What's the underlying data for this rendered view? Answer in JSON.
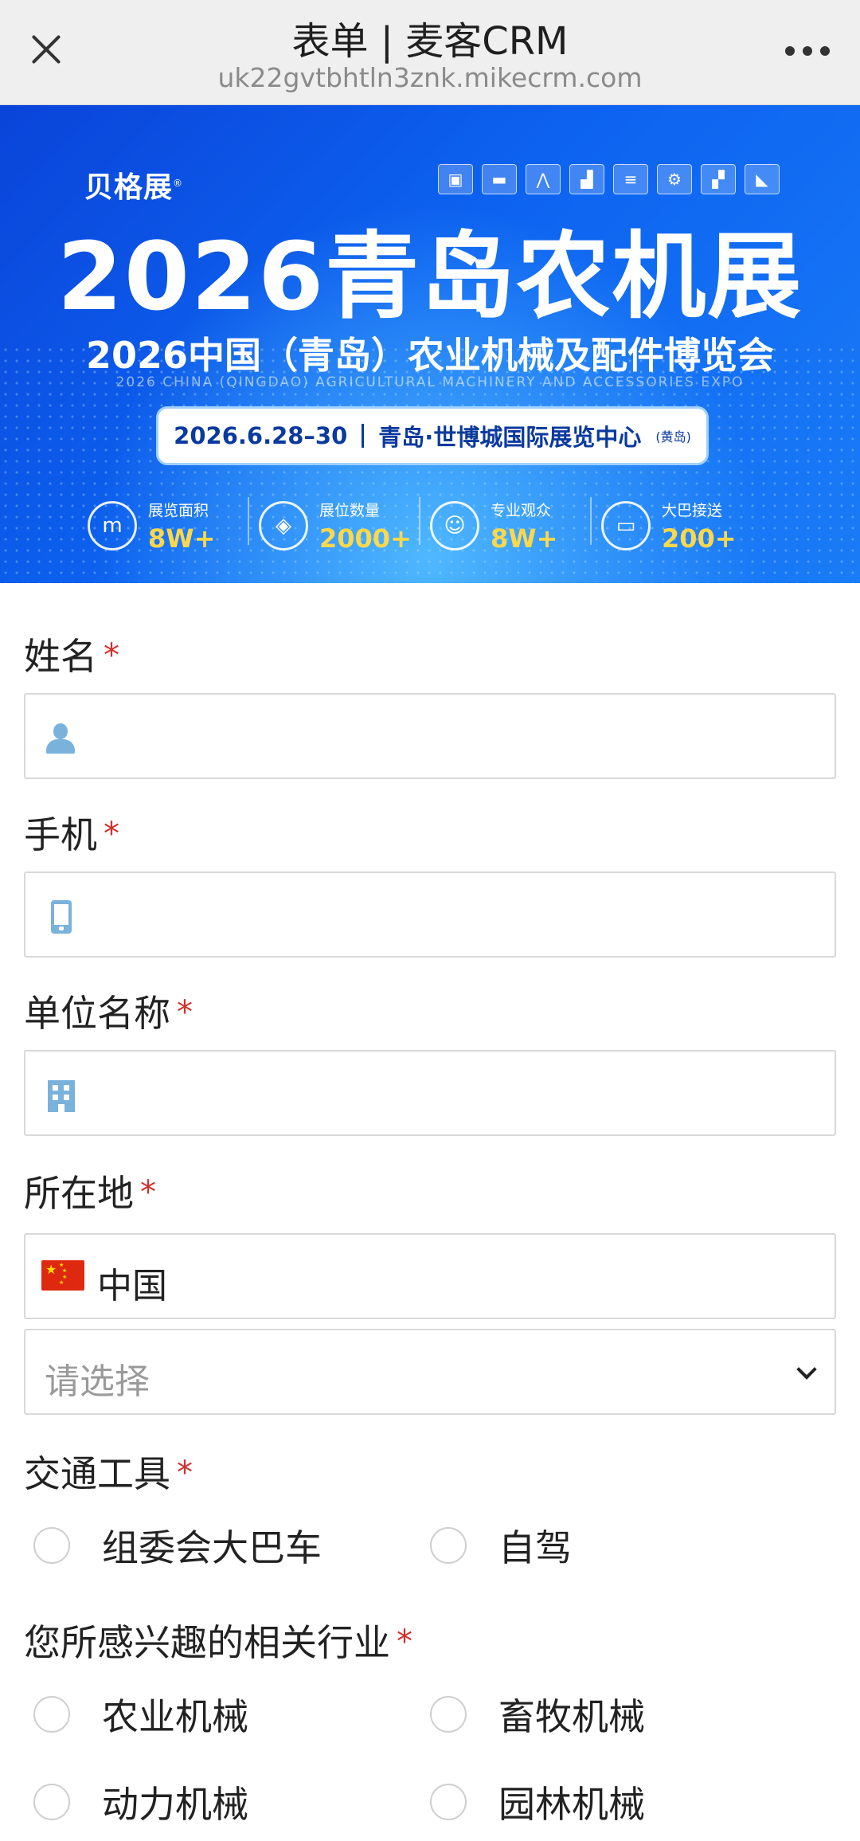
{
  "window": {
    "title": "表单 | 麦客CRM",
    "url": "uk22gvtbhtln3znk.mikecrm.com"
  },
  "banner": {
    "brand": "贝格展",
    "brand_mark": "®",
    "title": "2026青岛农机展",
    "subtitle": "2026中国（青岛）农业机械及配件博览会",
    "english": "2026 CHINA (QINGDAO) AGRICULTURAL MACHINERY AND ACCESSORIES EXPO",
    "date": "2026.6.28–30",
    "venue": "青岛·世博城国际展览中心",
    "venue_note": "(黄岛)",
    "stats": [
      {
        "label": "展览面积",
        "value": "8W+",
        "icon": "area-icon"
      },
      {
        "label": "展位数量",
        "value": "2000+",
        "icon": "layers-icon"
      },
      {
        "label": "专业观众",
        "value": "8W+",
        "icon": "people-icon"
      },
      {
        "label": "大巴接送",
        "value": "200+",
        "icon": "bus-icon"
      }
    ]
  },
  "form": {
    "name": {
      "label": "姓名",
      "required": "*"
    },
    "phone": {
      "label": "手机",
      "required": "*"
    },
    "company": {
      "label": "单位名称",
      "required": "*"
    },
    "location": {
      "label": "所在地",
      "required": "*",
      "country": "中国",
      "region_placeholder": "请选择"
    },
    "transport": {
      "label": "交通工具",
      "required": "*",
      "options": [
        "组委会大巴车",
        "自驾"
      ]
    },
    "industry": {
      "label": "您所感兴趣的相关行业",
      "required": "*",
      "options": [
        "农业机械",
        "畜牧机械",
        "动力机械",
        "园林机械"
      ]
    }
  },
  "colors": {
    "required_star": "#d0312d",
    "banner_blue": "#0d63f0",
    "stat_value": "#ffd84a",
    "icon_blue": "#7ab2dc"
  }
}
